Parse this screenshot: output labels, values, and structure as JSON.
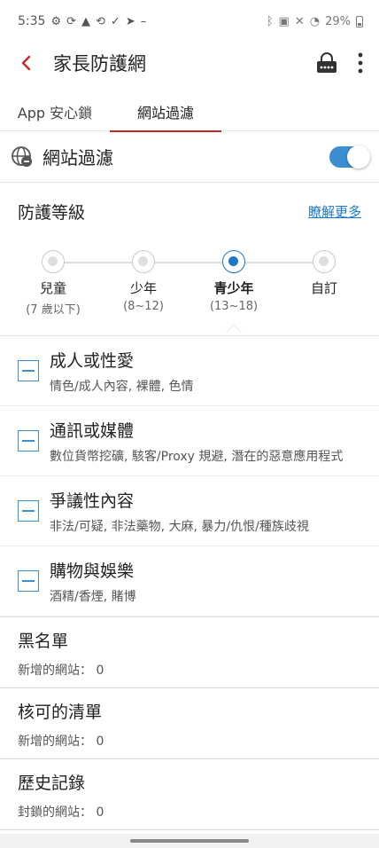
{
  "status_bar": {
    "time": "5:35",
    "battery": "29%"
  },
  "header": {
    "title": "家長防護網"
  },
  "tabs": [
    {
      "label": "App 安心鎖"
    },
    {
      "label": "網站過濾"
    }
  ],
  "web_filter": {
    "title": "網站過濾",
    "enabled": true
  },
  "protection_level": {
    "title": "防護等級",
    "learn_more": "瞭解更多",
    "levels": [
      {
        "name": "兒童",
        "age": "(7 歲以下)"
      },
      {
        "name": "少年",
        "age": "(8~12)"
      },
      {
        "name": "青少年",
        "age": "(13~18)"
      },
      {
        "name": "自訂",
        "age": ""
      }
    ],
    "selected": "青少年"
  },
  "categories": [
    {
      "title": "成人或性愛",
      "desc": "情色/成人內容, 裸體, 色情"
    },
    {
      "title": "通訊或媒體",
      "desc": "數位貨幣挖礦, 駭客/Proxy 規避, 潛在的惡意應用程式"
    },
    {
      "title": "爭議性內容",
      "desc": "非法/可疑, 非法藥物, 大麻, 暴力/仇恨/種族歧視"
    },
    {
      "title": "購物與娛樂",
      "desc": "酒精/香煙, 賭博"
    }
  ],
  "lists": {
    "blacklist": {
      "title": "黑名單",
      "meta": "新增的網站： 0"
    },
    "whitelist": {
      "title": "核可的清單",
      "meta": "新增的網站： 0"
    },
    "history": {
      "title": "歷史記錄",
      "meta": "封鎖的網站： 0"
    }
  },
  "colors": {
    "accent": "#c62828",
    "primary": "#3d8ed0",
    "link": "#1b78c8"
  }
}
